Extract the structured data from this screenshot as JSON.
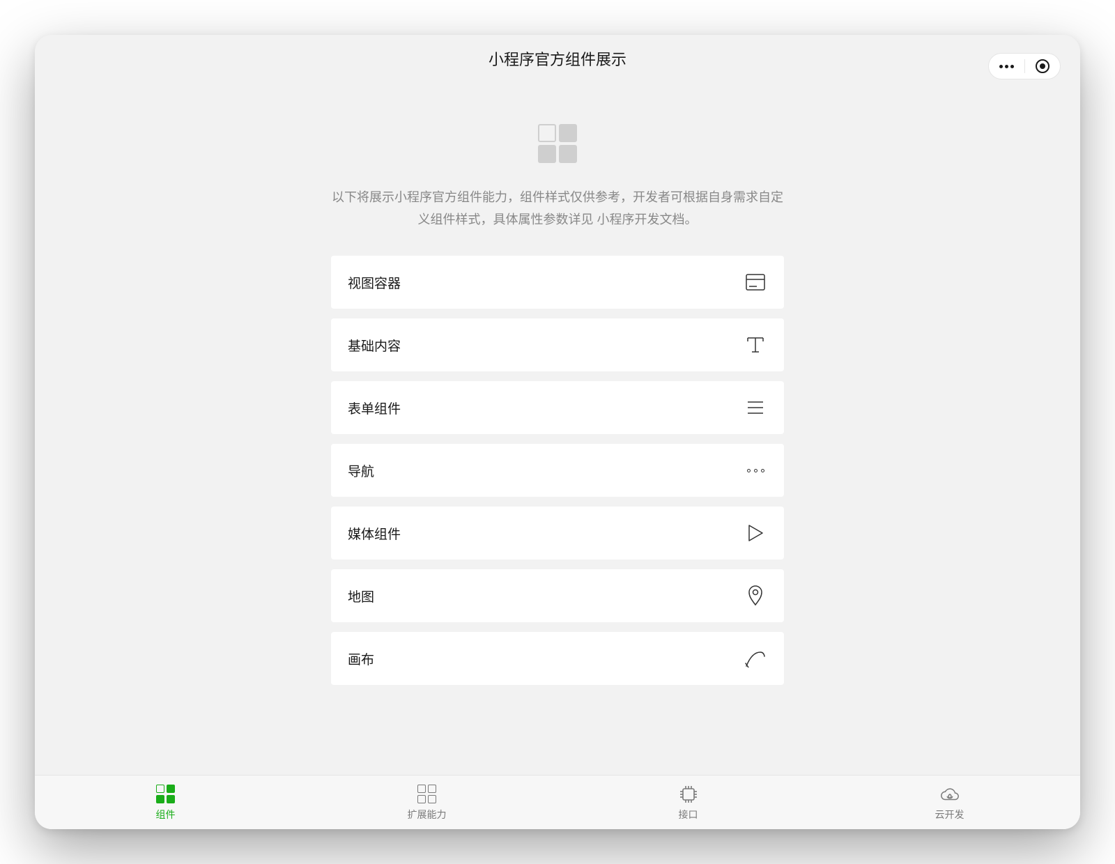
{
  "header": {
    "title": "小程序官方组件展示"
  },
  "intro": {
    "desc_before": "以下将展示小程序官方组件能力，组件样式仅供参考，开发者可根据自身需求自定义组件样式，具体属性参数详见 ",
    "desc_link": "小程序开发文档",
    "desc_after": "。"
  },
  "list": [
    {
      "label": "视图容器",
      "icon": "panel-icon"
    },
    {
      "label": "基础内容",
      "icon": "text-icon"
    },
    {
      "label": "表单组件",
      "icon": "list-lines-icon"
    },
    {
      "label": "导航",
      "icon": "nav-dots-icon"
    },
    {
      "label": "媒体组件",
      "icon": "play-icon"
    },
    {
      "label": "地图",
      "icon": "location-icon"
    },
    {
      "label": "画布",
      "icon": "curve-icon"
    }
  ],
  "tabbar": [
    {
      "label": "组件",
      "icon": "components-tab-icon",
      "active": true
    },
    {
      "label": "扩展能力",
      "icon": "extend-tab-icon",
      "active": false
    },
    {
      "label": "接口",
      "icon": "api-tab-icon",
      "active": false
    },
    {
      "label": "云开发",
      "icon": "cloud-tab-icon",
      "active": false
    }
  ]
}
